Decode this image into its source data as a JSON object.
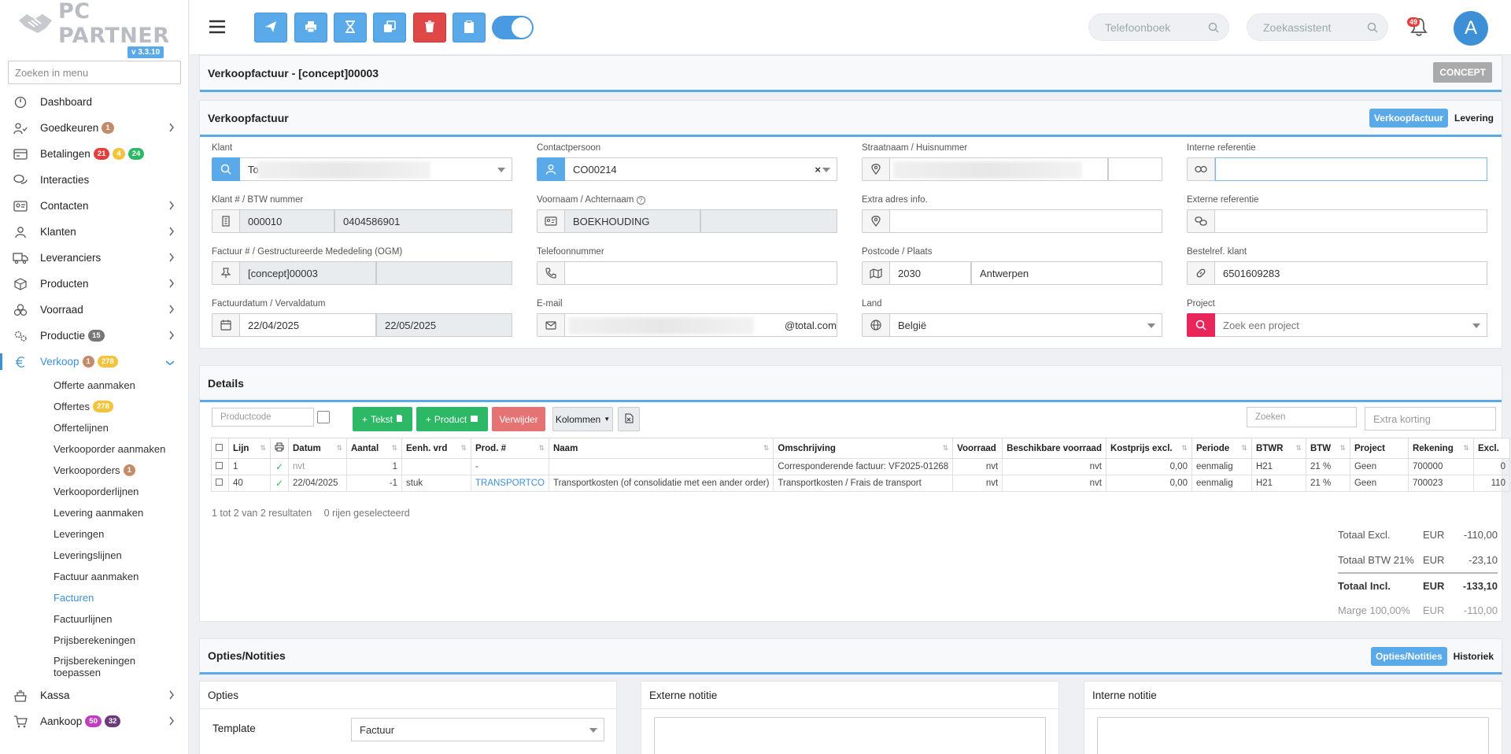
{
  "app": {
    "logo_text": "PC PARTNER",
    "version": "v 3.3.10",
    "menu_search_placeholder": "Zoeken in menu"
  },
  "sidebar": {
    "items": [
      {
        "label": "Dashboard",
        "icon": "dashboard-icon"
      },
      {
        "label": "Goedkeuren",
        "icon": "user-check-icon",
        "badges": [
          "1"
        ],
        "chevron": true
      },
      {
        "label": "Betalingen",
        "icon": "payments-icon",
        "badges": [
          "21",
          "4",
          "24"
        ]
      },
      {
        "label": "Interacties",
        "icon": "chat-icon"
      },
      {
        "label": "Contacten",
        "icon": "contact-card-icon",
        "chevron": true
      },
      {
        "label": "Klanten",
        "icon": "user-icon",
        "chevron": true
      },
      {
        "label": "Leveranciers",
        "icon": "truck-icon",
        "chevron": true
      },
      {
        "label": "Producten",
        "icon": "box-icon",
        "chevron": true
      },
      {
        "label": "Voorraad",
        "icon": "stock-icon",
        "chevron": true
      },
      {
        "label": "Productie",
        "icon": "gears-icon",
        "badges": [
          "15"
        ],
        "chevron": true
      },
      {
        "label": "Verkoop",
        "icon": "euro-icon",
        "badges": [
          "1",
          "278"
        ],
        "chevron": true
      },
      {
        "label": "Kassa",
        "icon": "register-icon",
        "chevron": true
      },
      {
        "label": "Aankoop",
        "icon": "cart-icon",
        "badges": [
          "50",
          "32"
        ],
        "chevron": true
      }
    ],
    "verkoop_sub": [
      {
        "label": "Offerte aanmaken"
      },
      {
        "label": "Offertes",
        "badge": "278"
      },
      {
        "label": "Offertelijnen"
      },
      {
        "label": "Verkooporder aanmaken"
      },
      {
        "label": "Verkooporders",
        "badge": "1"
      },
      {
        "label": "Verkooporderlijnen"
      },
      {
        "label": "Levering aanmaken"
      },
      {
        "label": "Leveringen"
      },
      {
        "label": "Leveringslijnen"
      },
      {
        "label": "Factuur aanmaken"
      },
      {
        "label": "Facturen"
      },
      {
        "label": "Factuurlijnen"
      },
      {
        "label": "Prijsberekeningen"
      },
      {
        "label": "Prijsberekeningen toepassen"
      }
    ]
  },
  "topbar": {
    "phonebook_placeholder": "Telefoonboek",
    "assistant_placeholder": "Zoekassistent",
    "notifications": "49",
    "avatar": "A"
  },
  "page": {
    "title": "Verkoopfactuur - [concept]00003",
    "status": "CONCEPT"
  },
  "invoice": {
    "title": "Verkoopfactuur",
    "tab_active": "Verkoopfactuur",
    "tab_other": "Levering",
    "fields": {
      "klant_label": "Klant",
      "klant_value": "To",
      "contact_label": "Contactpersoon",
      "contact_value": "CO00214",
      "contact_clear": "×",
      "straat_label": "Straatnaam / Huisnummer",
      "intref_label": "Interne referentie",
      "klantnr_label": "Klant # / BTW nummer",
      "klantnr_value": "000010",
      "btw_value": "0404586901",
      "naam_label": "Voornaam / Achternaam",
      "naam_value": "BOEKHOUDING",
      "extra_label": "Extra adres info.",
      "extref_label": "Externe referentie",
      "factuur_label": "Factuur # / Gestructureerde Mededeling (OGM)",
      "factuur_value": "[concept]00003",
      "tel_label": "Telefoonnummer",
      "postcode_label": "Postcode / Plaats",
      "postcode_value": "2030",
      "plaats_value": "Antwerpen",
      "bestel_label": "Bestelref. klant",
      "bestel_value": "6501609283",
      "datum_label": "Factuurdatum / Vervaldatum",
      "datum_value": "22/04/2025",
      "verval_value": "22/05/2025",
      "email_label": "E-mail",
      "email_value": "@total.com",
      "land_label": "Land",
      "land_value": "België",
      "project_label": "Project",
      "project_placeholder": "Zoek een project"
    }
  },
  "details": {
    "title": "Details",
    "productcode_placeholder": "Productcode",
    "btn_tekst": "Tekst",
    "btn_product": "Product",
    "btn_verwijder": "Verwijder",
    "btn_kolommen": "Kolommen",
    "search_placeholder": "Zoeken",
    "korting_placeholder": "Extra korting",
    "columns": [
      "Lijn",
      "",
      "Datum",
      "Aantal",
      "Eenh. vrd",
      "Prod. #",
      "Naam",
      "Omschrijving",
      "Voorraad",
      "Beschikbare voorraad",
      "Kostprijs excl.",
      "Periode",
      "BTWR",
      "BTW",
      "Project",
      "Rekening",
      "Excl."
    ],
    "rows": [
      [
        "1",
        "",
        "nvt",
        "1",
        "",
        "-",
        "",
        "Corresponderende factuur: VF2025-01268",
        "nvt",
        "nvt",
        "0,00",
        "eenmalig",
        "H21",
        "21 %",
        "Geen",
        "700000",
        "0"
      ],
      [
        "40",
        "",
        "22/04/2025",
        "-1",
        "stuk",
        "TRANSPORTCO",
        "Transportkosten (of consolidatie met een ander order)",
        "Transportkosten / Frais de transport",
        "nvt",
        "nvt",
        "0,00",
        "eenmalig",
        "H21",
        "21 %",
        "Geen",
        "700023",
        "110"
      ]
    ],
    "result_text": "1 tot 2 van 2 resultaten",
    "selected_text": "0 rijen geselecteerd",
    "totals": [
      {
        "label": "Totaal Excl.",
        "cur": "EUR",
        "value": "-110,00"
      },
      {
        "label": "Totaal BTW 21%",
        "cur": "EUR",
        "value": "-23,10"
      },
      {
        "label": "Totaal Incl.",
        "cur": "EUR",
        "value": "-133,10"
      },
      {
        "label": "Marge 100,00%",
        "cur": "EUR",
        "value": "-110,00"
      }
    ]
  },
  "options": {
    "title": "Opties/Notities",
    "tab_active": "Opties/Notities",
    "tab_other": "Historiek",
    "opties_title": "Opties",
    "template_label": "Template",
    "template_value": "Factuur",
    "externe_title": "Externe notitie",
    "interne_title": "Interne notitie"
  }
}
